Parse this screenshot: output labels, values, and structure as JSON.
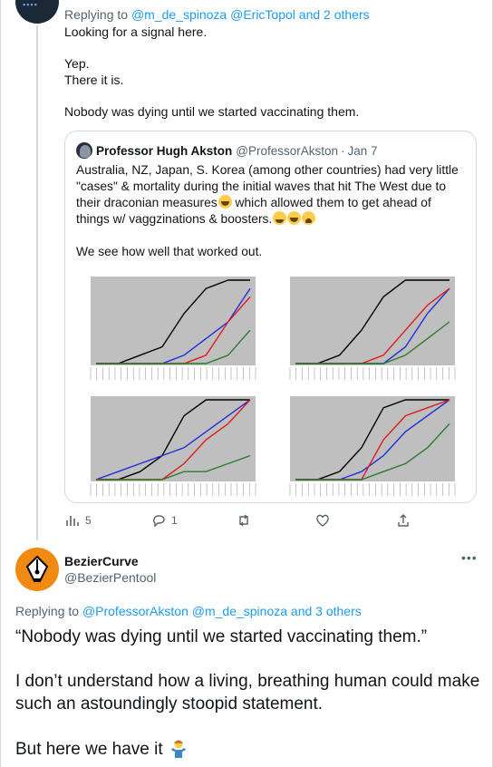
{
  "tweet1": {
    "replying_prefix": "Replying to ",
    "replying_users": "@m_de_spinoza @EricTopol",
    "replying_and": " and ",
    "replying_others": "2 others",
    "lines": [
      "Looking for a signal here.",
      "",
      "Yep.",
      "There it is.",
      "",
      "Nobody was dying until we started vaccinating them."
    ],
    "actions": {
      "replies": "5",
      "retweets": "1"
    }
  },
  "quote": {
    "name": "Professor Hugh Akston",
    "handle": "@ProfessorAkston",
    "separator": "·",
    "date": "Jan 7",
    "text_1": "Australia, NZ, Japan, S. Korea (among other countries) had very little \"cases\" & mortality during the initial waves that hit The West due to their draconian measures",
    "text_2": " which allowed them to get ahead of things w/ vaggzinations & boosters.",
    "text_3": "We see how well that worked out."
  },
  "tweet2": {
    "name": "BezierCurve",
    "handle": "@BezierPentool",
    "more": "•••",
    "replying_prefix": "Replying to ",
    "replying_users": "@ProfessorAkston @m_de_spinoza",
    "replying_and": " and ",
    "replying_others": "3 others",
    "para1": "“Nobody was dying until we started vaccinating them.”",
    "para2": "I don’t understand how a living, breathing human could make such an astoundingly stoopid statement.",
    "para3": "But here we have it"
  },
  "colors": {
    "link": "#1d9bf0",
    "muted": "#536471",
    "border": "#cfd9de",
    "avatar_orange": "#f08a13",
    "chart_bg": "#bfbfbf",
    "series_black": "#000000",
    "series_red": "#e01b1b",
    "series_blue": "#1f2fd6",
    "series_green": "#2f7a2f"
  },
  "icons": [
    "analytics-icon",
    "reply-icon",
    "retweet-icon",
    "like-icon",
    "share-icon",
    "fountain-pen-icon",
    "person-shrugging-icon"
  ],
  "chart_data": [
    {
      "type": "line",
      "series": [
        {
          "values": [
            0,
            0,
            1,
            2,
            6,
            9,
            10,
            10
          ]
        },
        {
          "values": [
            0,
            0,
            0,
            0,
            1,
            3,
            5,
            9
          ]
        },
        {
          "values": [
            0,
            0,
            0,
            0,
            0,
            1,
            5,
            8
          ]
        },
        {
          "values": [
            0,
            0,
            0,
            0,
            0,
            0,
            1,
            4
          ]
        }
      ]
    },
    {
      "type": "line",
      "series": [
        {
          "values": [
            0,
            0,
            1,
            4,
            8,
            10,
            10,
            10
          ]
        },
        {
          "values": [
            0,
            0,
            0,
            0,
            0,
            2,
            6,
            9
          ]
        },
        {
          "values": [
            0,
            0,
            0,
            0,
            1,
            4,
            7,
            9
          ]
        },
        {
          "values": [
            0,
            0,
            0,
            0,
            0,
            1,
            3,
            5
          ]
        }
      ]
    },
    {
      "type": "line",
      "series": [
        {
          "values": [
            0,
            0,
            1,
            3,
            8,
            10,
            10,
            10
          ]
        },
        {
          "values": [
            0,
            1,
            2,
            3,
            4,
            6,
            8,
            10
          ]
        },
        {
          "values": [
            0,
            0,
            0,
            0,
            2,
            5,
            7,
            10
          ]
        },
        {
          "values": [
            0,
            0,
            0,
            0,
            1,
            1,
            2,
            3
          ]
        }
      ]
    },
    {
      "type": "line",
      "series": [
        {
          "values": [
            0,
            0,
            1,
            4,
            9,
            10,
            10,
            10
          ]
        },
        {
          "values": [
            0,
            0,
            0,
            1,
            3,
            6,
            8,
            10
          ]
        },
        {
          "values": [
            0,
            0,
            0,
            0,
            5,
            8,
            9,
            10
          ]
        },
        {
          "values": [
            0,
            0,
            0,
            0,
            1,
            2,
            4,
            7
          ]
        }
      ]
    }
  ]
}
